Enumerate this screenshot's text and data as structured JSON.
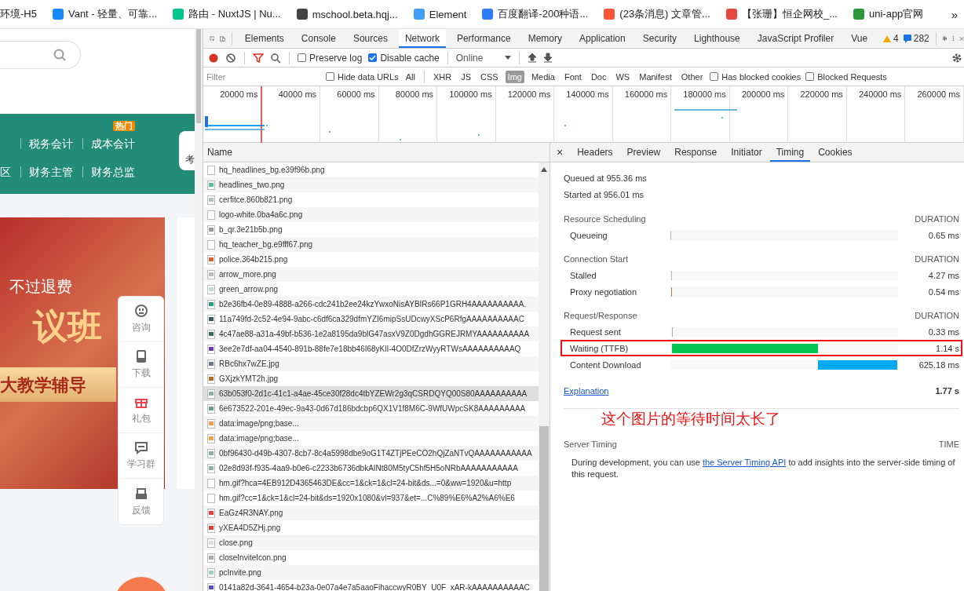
{
  "bookmarks": [
    {
      "label": "环境-H5"
    },
    {
      "label": "Vant - 轻量、可靠...",
      "color": "#1989fa"
    },
    {
      "label": "路由 - NuxtJS | Nu...",
      "color": "#00c58e"
    },
    {
      "label": "mschool.beta.hqj...",
      "color": "#444444"
    },
    {
      "label": "Element",
      "color": "#409eff"
    },
    {
      "label": "百度翻译-200种语...",
      "color": "#2b7cf6"
    },
    {
      "label": "(23条消息) 文章管...",
      "color": "#fc5531"
    },
    {
      "label": "【张珊】恒企网校_...",
      "color": "#e8483f"
    },
    {
      "label": "uni-app官网",
      "color": "#2b9939"
    }
  ],
  "bookmarks_more": "»",
  "website": {
    "nav_rows": [
      [
        "税务会计",
        "成本会计"
      ],
      [
        "区",
        "财务主管",
        "财务总监"
      ]
    ],
    "hot_badge": "热门",
    "side_button": "考",
    "banner": {
      "line1": "不过退费",
      "line2": "议班",
      "ribbon": "大教学辅导"
    },
    "float_menu": [
      {
        "label": "咨询",
        "kind": "chat",
        "color": "#666666"
      },
      {
        "label": "下载",
        "kind": "tablet",
        "color": "#666666"
      },
      {
        "label": "礼包",
        "kind": "gift",
        "color": "#f0434e"
      },
      {
        "label": "学习群",
        "kind": "group",
        "color": "#666666"
      },
      {
        "label": "反馈",
        "kind": "mail",
        "color": "#666666"
      }
    ]
  },
  "devtools": {
    "tabs": [
      {
        "label": "Elements",
        "selected": false
      },
      {
        "label": "Console",
        "selected": false
      },
      {
        "label": "Sources",
        "selected": false
      },
      {
        "label": "Network",
        "selected": true
      },
      {
        "label": "Performance",
        "selected": false
      },
      {
        "label": "Memory",
        "selected": false
      },
      {
        "label": "Application",
        "selected": false
      },
      {
        "label": "Security",
        "selected": false
      },
      {
        "label": "Lighthouse",
        "selected": false
      },
      {
        "label": "JavaScript Profiler",
        "selected": false
      },
      {
        "label": "Vue",
        "selected": false
      }
    ],
    "warnings": "4",
    "messages": "282",
    "toolbar": {
      "preserve_log": {
        "label": "Preserve log",
        "checked": false
      },
      "disable_cache": {
        "label": "Disable cache",
        "checked": true
      },
      "throttling": "Online"
    },
    "filter": {
      "placeholder": "Filter",
      "hide_data_urls": {
        "label": "Hide data URLs",
        "checked": false
      },
      "types": [
        {
          "label": "All",
          "selected": false
        },
        {
          "label": "XHR",
          "selected": false
        },
        {
          "label": "JS",
          "selected": false
        },
        {
          "label": "CSS",
          "selected": false
        },
        {
          "label": "Img",
          "selected": true
        },
        {
          "label": "Media",
          "selected": false
        },
        {
          "label": "Font",
          "selected": false
        },
        {
          "label": "Doc",
          "selected": false
        },
        {
          "label": "WS",
          "selected": false
        },
        {
          "label": "Manifest",
          "selected": false
        },
        {
          "label": "Other",
          "selected": false
        }
      ],
      "blocked_cookies": {
        "label": "Has blocked cookies",
        "checked": false
      },
      "blocked_requests": {
        "label": "Blocked Requests",
        "checked": false
      }
    },
    "overview_ticks": [
      "20000 ms",
      "40000 ms",
      "60000 ms",
      "80000 ms",
      "100000 ms",
      "120000 ms",
      "140000 ms",
      "160000 ms",
      "180000 ms",
      "200000 ms",
      "220000 ms",
      "240000 ms",
      "260000 ms"
    ],
    "list": {
      "column": "Name",
      "rows": [
        {
          "name": "hq_headlines_bg.e39f96b.png",
          "selected": false,
          "color": "#ffffff"
        },
        {
          "name": "headlines_two.png",
          "selected": false,
          "color": "#5bbf9f"
        },
        {
          "name": "cerfitce.860b821.png",
          "selected": false,
          "color": "#a8c8b8"
        },
        {
          "name": "logo-white.0ba4a6c.png",
          "selected": false,
          "color": "#ffffff"
        },
        {
          "name": "b_qr.3e21b5b.png",
          "selected": false,
          "color": "#999999"
        },
        {
          "name": "hq_teacher_bg.e9fff67.png",
          "selected": false,
          "color": "#ffffff"
        },
        {
          "name": "police.364b215.png",
          "selected": false,
          "color": "#d9602a"
        },
        {
          "name": "arrow_more.png",
          "selected": false,
          "color": "#bbbbbb"
        },
        {
          "name": "green_arrow.png",
          "selected": false,
          "color": "#b8e0d0"
        },
        {
          "name": "b2e36fb4-0e89-4888-a266-cdc241b2ee24kzYwxoNisAYBIRs66P1GRH4AAAAAAAAAA.",
          "selected": false,
          "color": "#23a07c"
        },
        {
          "name": "11a749fd-2c52-4e94-9abc-c6df6ca329dfmYZI6mipSsUDcwyXScP6RfgAAAAAAAAAAC",
          "selected": false,
          "color": "#3a5a70"
        },
        {
          "name": "4c47ae88-a31a-49bf-b536-1e2a8195da9blG47asxV9Z0DgdhGGREJRMYAAAAAAAAAA",
          "selected": false,
          "color": "#3a6a60"
        },
        {
          "name": "3ee2e7df-aa04-4540-891b-88fe7e18bb46I68yKlI-4O0DfZrzWyyRTWsAAAAAAAAAAQ",
          "selected": false,
          "color": "#6a3ab0"
        },
        {
          "name": "RBc6hx7wZE.jpg",
          "selected": false,
          "color": "#6a7a8a"
        },
        {
          "name": "GXjzkYMT2h.jpg",
          "selected": false,
          "color": "#b07020"
        },
        {
          "name": "63b053f0-2d1c-41c1-a4ae-45ce30f28dc4tbYZEWr2g3qCSRDQYQ00S80AAAAAAAAAA",
          "selected": true,
          "color": "#8ab0a0"
        },
        {
          "name": "6e673522-201e-49ec-9a43-0d67d186bdcbp6QX1V1f8M6C-9WfUWpcSK8AAAAAAAAA",
          "selected": false,
          "color": "#6a9a8a"
        },
        {
          "name": "data:image/png;base...",
          "selected": false,
          "color": "#f0a040"
        },
        {
          "name": "data:image/png;base...",
          "selected": false,
          "color": "#f0a040"
        },
        {
          "name": "0bf96430-d49b-4307-8cb7-8c4a5998dbe9oG1T4ZTjPEeCO2hQjZaNTvQAAAAAAAAAAA",
          "selected": false,
          "color": "#8ab0a0"
        },
        {
          "name": "02e8d93f-f935-4aa9-b0e6-c2233b6736dbkAINt80M5tyC5hf5H5oNRbAAAAAAAAAAA",
          "selected": false,
          "color": "#8ab0a0"
        },
        {
          "name": "hm.gif?hca=4EB912D4365463DE&cc=1&ck=1&cl=24-bit&ds...=0&ww=1920&u=http",
          "selected": false,
          "color": "#ffffff"
        },
        {
          "name": "hm.gif?cc=1&ck=1&cl=24-bit&ds=1920x1080&vl=937&et=...C%89%E6%A2%A6%E6",
          "selected": false,
          "color": "#ffffff"
        },
        {
          "name": "EaGz4R3NAY.png",
          "selected": false,
          "color": "#e04040"
        },
        {
          "name": "yXEA4D5ZHj.png",
          "selected": false,
          "color": "#d84030"
        },
        {
          "name": "close.png",
          "selected": false,
          "color": "#dddddd"
        },
        {
          "name": "closeInviteIcon.png",
          "selected": false,
          "color": "#aaaaaa"
        },
        {
          "name": "pcInvite.png",
          "selected": false,
          "color": "#a0d0c0"
        },
        {
          "name": "0141a82d-3641-4654-b23a-0e07a4e7a5aaoFihaccwyR0BY_U0F_xAR-kAAAAAAAAAAC",
          "selected": false,
          "color": "#5050c0"
        }
      ]
    },
    "detail": {
      "close": "×",
      "tabs": [
        {
          "label": "Headers",
          "selected": false
        },
        {
          "label": "Preview",
          "selected": false
        },
        {
          "label": "Response",
          "selected": false
        },
        {
          "label": "Initiator",
          "selected": false
        },
        {
          "label": "Timing",
          "selected": true
        },
        {
          "label": "Cookies",
          "selected": false
        }
      ],
      "queued": "Queued at 955.36 ms",
      "started": "Started at 956.01 ms",
      "sections": [
        {
          "title": "Resource Scheduling",
          "column": "DURATION",
          "rows": [
            {
              "label": "Queueing",
              "value": "0.65 ms",
              "level": 0.002,
              "color": "#bbbbbb",
              "highlighted": false
            }
          ]
        },
        {
          "title": "Connection Start",
          "column": "DURATION",
          "rows": [
            {
              "label": "Stalled",
              "value": "4.27 ms",
              "level": 0.002,
              "color": "#bbbbbb",
              "highlighted": false
            },
            {
              "label": "Proxy negotiation",
              "value": "0.54 ms",
              "level": 0.002,
              "color": "#b08060",
              "highlighted": false
            }
          ]
        },
        {
          "title": "Request/Response",
          "column": "DURATION",
          "rows": [
            {
              "label": "Request sent",
              "value": "0.33 ms",
              "level": 0.002,
              "color": "#9ab0c0",
              "highlighted": false
            },
            {
              "label": "Waiting (TTFB)",
              "value": "1.14 s",
              "level": 0.64,
              "color": "#00c350",
              "highlighted": true
            },
            {
              "label": "Content Download",
              "value": "625.18 ms",
              "level": 0.35,
              "color": "#03a9f4",
              "highlighted": false
            }
          ]
        }
      ],
      "explanation": "Explanation",
      "total": "1.77 s",
      "annotation": "这个图片的等待时间太长了",
      "server_timing": {
        "title": "Server Timing",
        "column": "TIME",
        "text_before": "During development, you can use ",
        "link": "the Server Timing API",
        "text_after": " to add insights into the server-side timing of this request."
      }
    }
  }
}
